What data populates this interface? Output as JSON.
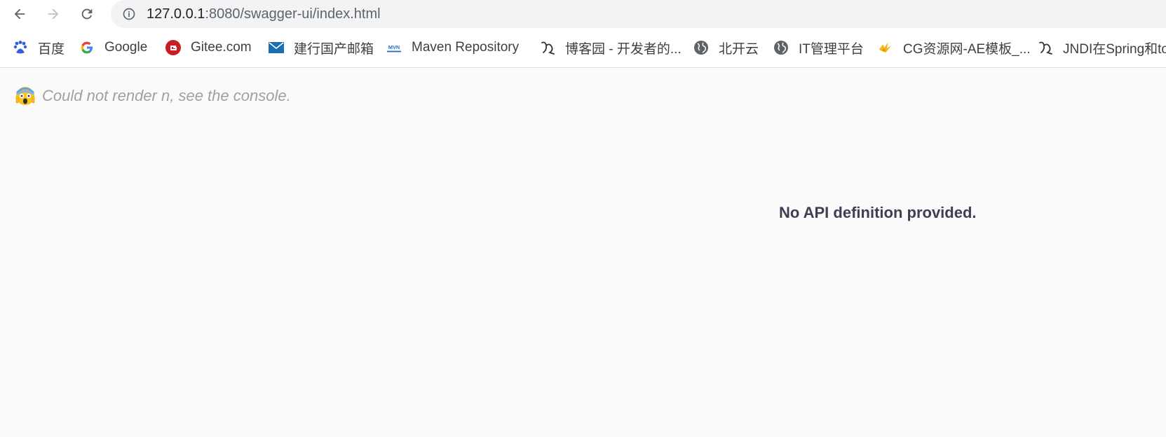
{
  "toolbar": {
    "url_host": "127.0.0.1",
    "url_rest": ":8080/swagger-ui/index.html"
  },
  "bookmarks": [
    {
      "label": "百度",
      "icon": "baidu-icon"
    },
    {
      "label": "Google",
      "icon": "google-icon"
    },
    {
      "label": "Gitee.com",
      "icon": "gitee-icon"
    },
    {
      "label": "建行国产邮箱",
      "icon": "mail-icon"
    },
    {
      "label": "Maven Repository",
      "icon": "maven-icon"
    },
    {
      "label": "博客园 - 开发者的...",
      "icon": "cnblogs-icon"
    },
    {
      "label": "北开云",
      "icon": "globe-icon"
    },
    {
      "label": "IT管理平台",
      "icon": "globe-icon"
    },
    {
      "label": "CG资源网-AE模板_...",
      "icon": "cg-icon"
    },
    {
      "label": "JNDI在Spring和to",
      "icon": "cnblogs-icon"
    }
  ],
  "main": {
    "error_message": "Could not render n, see the console.",
    "error_icon": "scream-emoji-icon",
    "no_api_message": "No API definition provided."
  },
  "colors": {
    "address_bar_bg": "#f1f3f4",
    "page_bg": "#fafafa",
    "error_text": "#a0a0a0",
    "heading_text": "#3b4151"
  }
}
